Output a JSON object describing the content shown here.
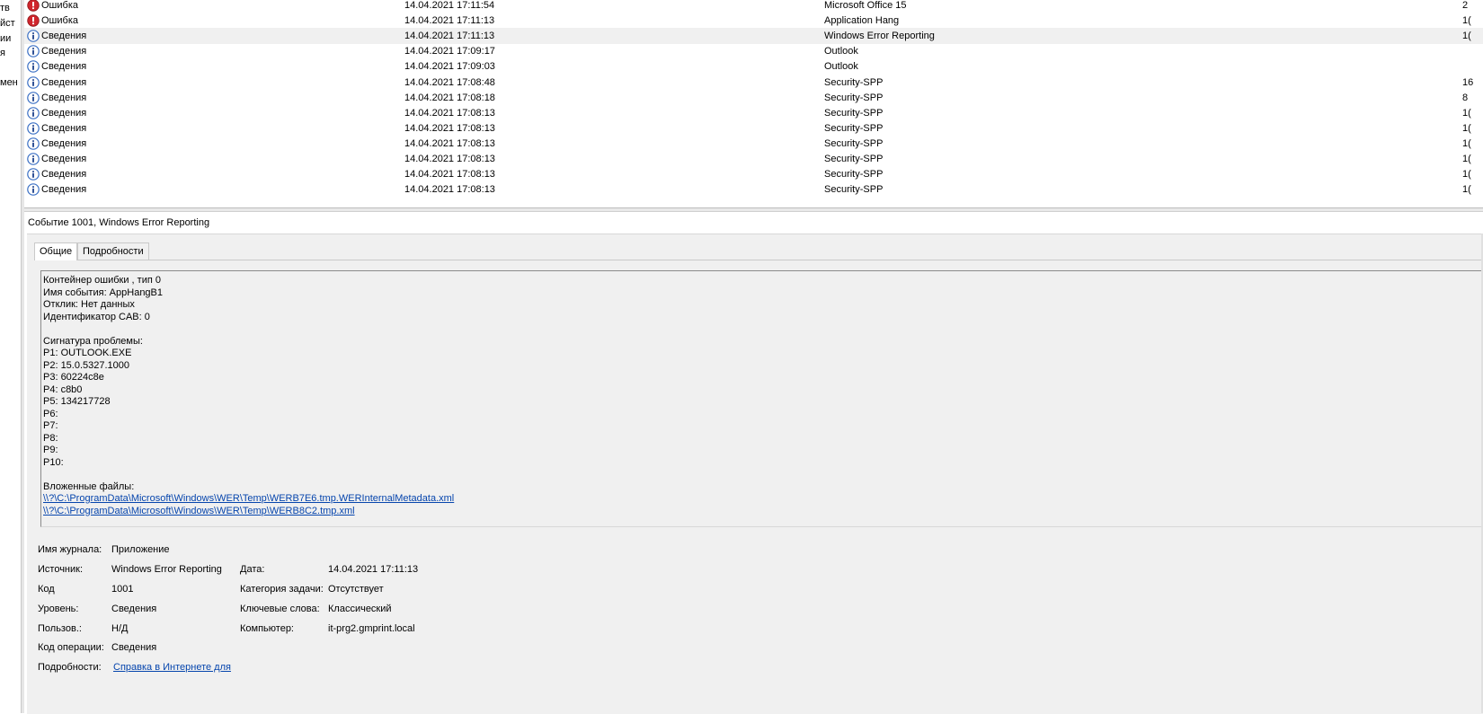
{
  "nav": {
    "items": [
      "тв",
      "йст",
      "ии",
      "я",
      "",
      "мен"
    ]
  },
  "event_list": {
    "rows": [
      {
        "level": "Ошибка",
        "type": "error",
        "date": "14.04.2021 17:11:54",
        "source": "Microsoft Office 15",
        "id": "2"
      },
      {
        "level": "Ошибка",
        "type": "error",
        "date": "14.04.2021 17:11:13",
        "source": "Application Hang",
        "id": "1("
      },
      {
        "level": "Сведения",
        "type": "info",
        "date": "14.04.2021 17:11:13",
        "source": "Windows Error Reporting",
        "id": "1(",
        "selected": true
      },
      {
        "level": "Сведения",
        "type": "info",
        "date": "14.04.2021 17:09:17",
        "source": "Outlook",
        "id": ""
      },
      {
        "level": "Сведения",
        "type": "info",
        "date": "14.04.2021 17:09:03",
        "source": "Outlook",
        "id": ""
      },
      {
        "level": "Сведения",
        "type": "info",
        "date": "14.04.2021 17:08:48",
        "source": "Security-SPP",
        "id": "16"
      },
      {
        "level": "Сведения",
        "type": "info",
        "date": "14.04.2021 17:08:18",
        "source": "Security-SPP",
        "id": "8"
      },
      {
        "level": "Сведения",
        "type": "info",
        "date": "14.04.2021 17:08:13",
        "source": "Security-SPP",
        "id": "1("
      },
      {
        "level": "Сведения",
        "type": "info",
        "date": "14.04.2021 17:08:13",
        "source": "Security-SPP",
        "id": "1("
      },
      {
        "level": "Сведения",
        "type": "info",
        "date": "14.04.2021 17:08:13",
        "source": "Security-SPP",
        "id": "1("
      },
      {
        "level": "Сведения",
        "type": "info",
        "date": "14.04.2021 17:08:13",
        "source": "Security-SPP",
        "id": "1("
      },
      {
        "level": "Сведения",
        "type": "info",
        "date": "14.04.2021 17:08:13",
        "source": "Security-SPP",
        "id": "1("
      },
      {
        "level": "Сведения",
        "type": "info",
        "date": "14.04.2021 17:08:13",
        "source": "Security-SPP",
        "id": "1("
      }
    ]
  },
  "detail": {
    "title": "Событие 1001, Windows Error Reporting",
    "tabs": [
      {
        "label": "Общие",
        "active": true
      },
      {
        "label": "Подробности",
        "active": false
      }
    ],
    "description_lines": [
      {
        "text": "Контейнер ошибки , тип 0"
      },
      {
        "text": "Имя события: AppHangB1"
      },
      {
        "text": "Отклик: Нет данных"
      },
      {
        "text": "Идентификатор CAB: 0"
      },
      {
        "text": ""
      },
      {
        "text": "Сигнатура проблемы:"
      },
      {
        "text": "P1: OUTLOOK.EXE"
      },
      {
        "text": "P2: 15.0.5327.1000"
      },
      {
        "text": "P3: 60224c8e"
      },
      {
        "text": "P4: c8b0"
      },
      {
        "text": "P5: 134217728"
      },
      {
        "text": "P6:"
      },
      {
        "text": "P7:"
      },
      {
        "text": "P8:"
      },
      {
        "text": "P9:"
      },
      {
        "text": "P10:"
      },
      {
        "text": ""
      },
      {
        "text": "Вложенные файлы:"
      },
      {
        "text": "\\\\?\\C:\\ProgramData\\Microsoft\\Windows\\WER\\Temp\\WERB7E6.tmp.WERInternalMetadata.xml",
        "link": true
      },
      {
        "text": "\\\\?\\C:\\ProgramData\\Microsoft\\Windows\\WER\\Temp\\WERB8C2.tmp.xml",
        "link": true
      }
    ],
    "properties": {
      "log_name": {
        "label": "Имя журнала:",
        "value": "Приложение"
      },
      "source": {
        "label": "Источник:",
        "value": "Windows Error Reporting"
      },
      "date": {
        "label": "Дата:",
        "value": "14.04.2021 17:11:13"
      },
      "event_id": {
        "label": "Код",
        "value": "1001"
      },
      "task_category": {
        "label": "Категория задачи:",
        "value": "Отсутствует"
      },
      "level": {
        "label": "Уровень:",
        "value": "Сведения"
      },
      "keywords": {
        "label": "Ключевые слова:",
        "value": "Классический"
      },
      "user": {
        "label": "Пользов.:",
        "value": "Н/Д"
      },
      "computer": {
        "label": "Компьютер:",
        "value": "it-prg2.gmprint.local"
      },
      "opcode": {
        "label": "Код операции:",
        "value": "Сведения"
      },
      "more_info": {
        "label": "Подробности:",
        "value": "Справка в Интернете для"
      }
    }
  },
  "colors": {
    "error_icon": "#d0262d",
    "info_icon": "#3a6fc4",
    "link": "#0645ad",
    "selected_row": "#f0f0f0"
  }
}
